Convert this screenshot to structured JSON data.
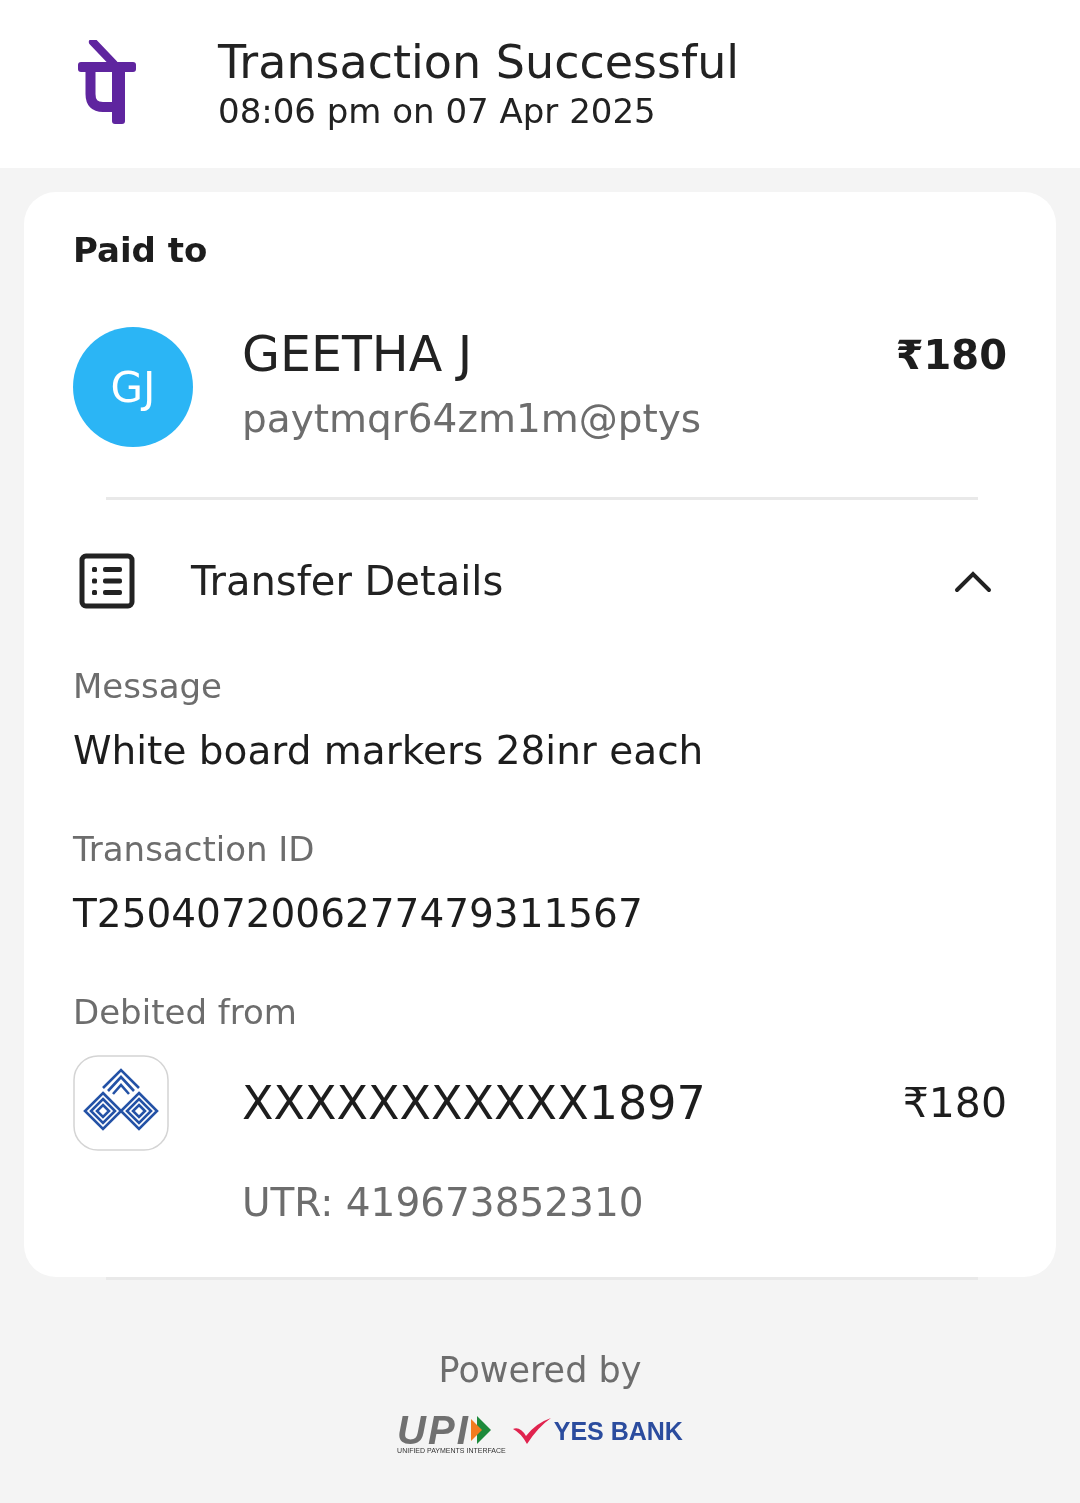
{
  "header": {
    "title": "Transaction Successful",
    "subtitle": "08:06 pm on 07 Apr 2025"
  },
  "paid_to": {
    "heading": "Paid to",
    "payee": {
      "initials": "GJ",
      "name": "GEETHA J",
      "upi_id": "paytmqr64zm1m@ptys",
      "amount": "₹180"
    }
  },
  "transfer_details": {
    "title": "Transfer Details",
    "expanded": true,
    "fields": [
      {
        "label": "Message",
        "value": "White board markers 28inr each"
      },
      {
        "label": "Transaction ID",
        "value": "T2504072006277479311567"
      }
    ],
    "debited_from": {
      "label": "Debited from",
      "account": "XXXXXXXXXXX1897",
      "amount": "₹180",
      "utr": "UTR: 419673852310"
    }
  },
  "footer": {
    "powered_by": "Powered by",
    "logos": [
      {
        "kind": "upi",
        "text": "UPI",
        "tagline": "UNIFIED PAYMENTS INTERFACE"
      },
      {
        "kind": "bank",
        "text": "YES BANK"
      }
    ]
  }
}
